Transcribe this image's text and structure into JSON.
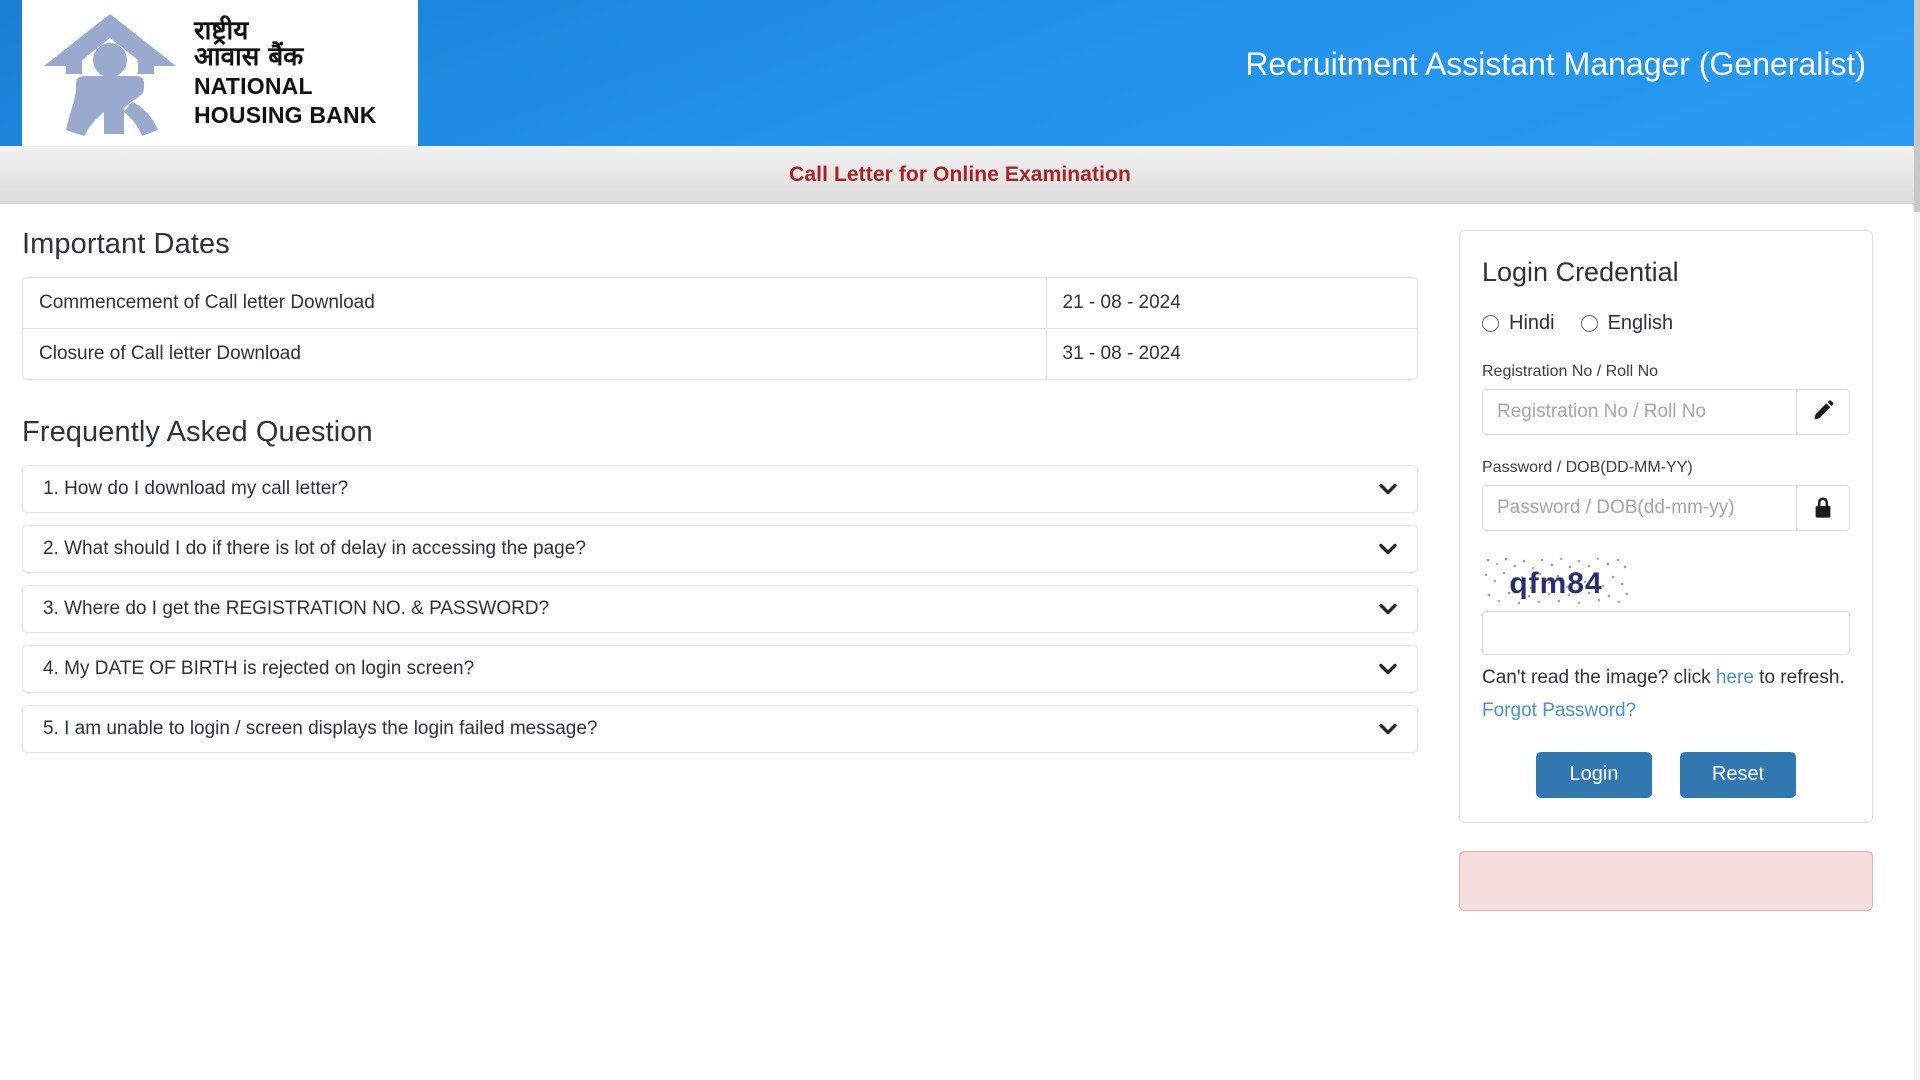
{
  "header": {
    "title": "Recruitment Assistant Manager (Generalist)",
    "logo": {
      "hindi_line1": "राष्ट्रीय",
      "hindi_line2": "आवास बैंक",
      "english_line1": "NATIONAL",
      "english_line2": "HOUSING BANK",
      "icon": "house-person-logo-icon"
    },
    "brand_color": "#2090e8"
  },
  "subtitle": {
    "text": "Call Letter for Online Examination",
    "color": "#a82424"
  },
  "important_dates": {
    "title": "Important Dates",
    "rows": [
      {
        "label": "Commencement of Call letter Download",
        "value": "21 - 08 - 2024"
      },
      {
        "label": "Closure of Call letter Download",
        "value": "31 - 08 - 2024"
      }
    ]
  },
  "faq": {
    "title": "Frequently Asked Question",
    "items": [
      {
        "text": "1. How do I download my call letter?",
        "icon": "chevron-down-icon"
      },
      {
        "text": "2. What should I do if there is lot of delay in accessing the page?",
        "icon": "chevron-down-icon"
      },
      {
        "text": "3. Where do I get the REGISTRATION NO. & PASSWORD?",
        "icon": "chevron-down-icon"
      },
      {
        "text": "4. My DATE OF BIRTH is rejected on login screen?",
        "icon": "chevron-down-icon"
      },
      {
        "text": "5. I am unable to login / screen displays the login failed message?",
        "icon": "chevron-down-icon"
      }
    ]
  },
  "login": {
    "title": "Login Credential",
    "language_options": [
      {
        "label": "Hindi",
        "selected": false
      },
      {
        "label": "English",
        "selected": false
      }
    ],
    "registration": {
      "label": "Registration No / Roll No",
      "placeholder": "Registration No / Roll No",
      "value": "",
      "addon_icon": "pencil-icon"
    },
    "password": {
      "label": "Password / DOB(DD-MM-YY)",
      "placeholder": "Password / DOB(dd-mm-yy)",
      "value": "",
      "addon_icon": "lock-icon"
    },
    "captcha": {
      "code": "qfm84",
      "value": "",
      "placeholder": "",
      "hint_prefix": "Can't read the image? click ",
      "hint_link": "here",
      "hint_suffix": " to refresh."
    },
    "forgot_password": "Forgot Password?",
    "buttons": {
      "login": "Login",
      "reset": "Reset"
    },
    "accent_color": "#3178b0",
    "link_color": "#4a90d9",
    "alert_color": "#f6dede"
  }
}
